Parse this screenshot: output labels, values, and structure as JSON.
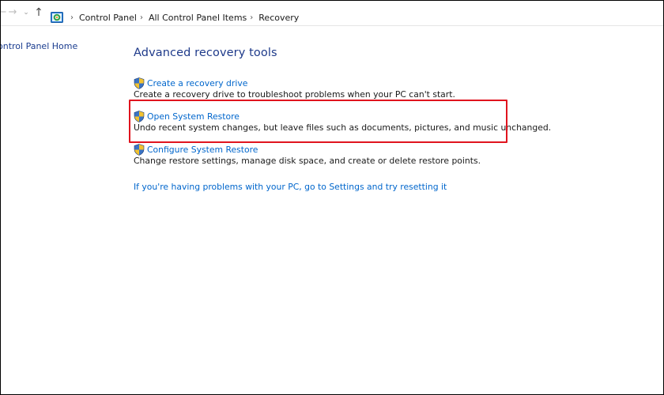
{
  "breadcrumb": {
    "items": [
      "Control Panel",
      "All Control Panel Items",
      "Recovery"
    ]
  },
  "left_pane": {
    "home_link": "ontrol Panel Home"
  },
  "main": {
    "heading": "Advanced recovery tools",
    "tasks": [
      {
        "link": "Create a recovery drive",
        "description": "Create a recovery drive to troubleshoot problems when your PC can't start."
      },
      {
        "link": "Open System Restore",
        "description": "Undo recent system changes, but leave files such as documents, pictures, and music unchanged.",
        "highlighted": true
      },
      {
        "link": "Configure System Restore",
        "description": "Change restore settings, manage disk space, and create or delete restore points."
      }
    ],
    "reset_link": "If you're having problems with your PC, go to Settings and try resetting it"
  },
  "colors": {
    "link": "#0066cc",
    "heading": "#1e3a8a",
    "highlight_border": "#e0141e",
    "text": "#1a1a1a"
  },
  "icons": [
    "back-arrow-icon",
    "forward-arrow-icon",
    "recent-locations-icon",
    "up-arrow-icon",
    "control-panel-icon",
    "uac-shield-icon"
  ]
}
